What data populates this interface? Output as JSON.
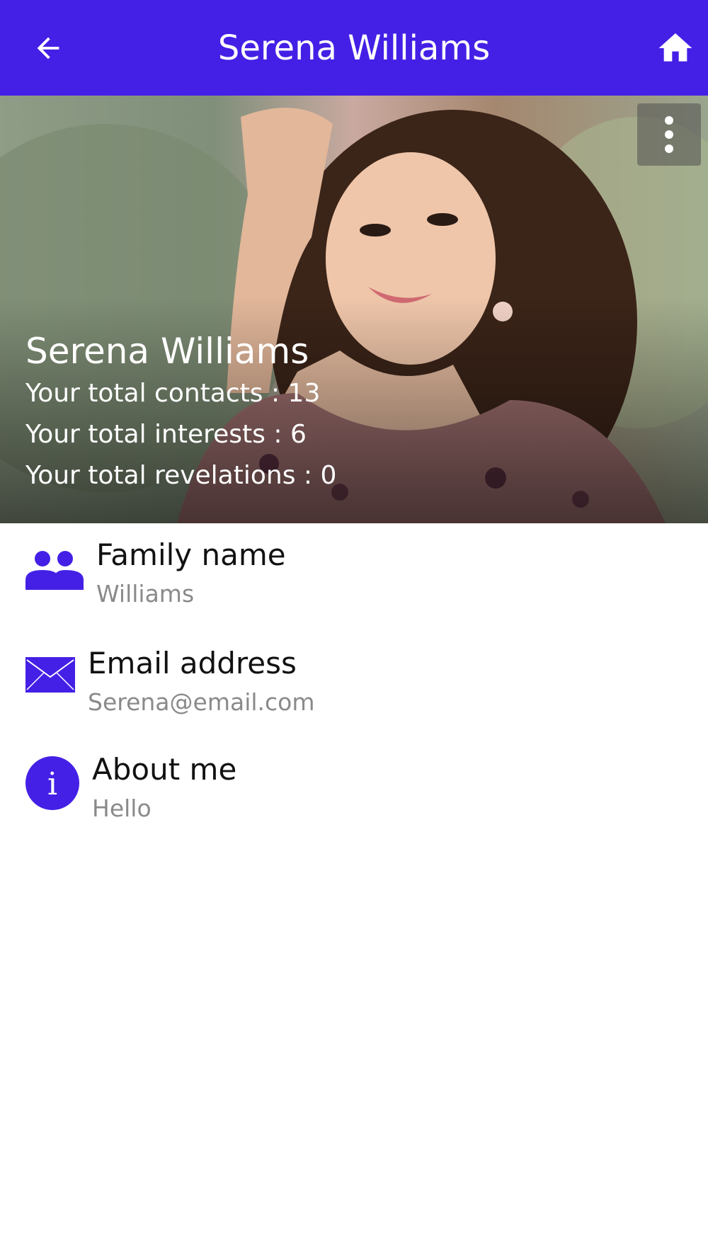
{
  "appbar": {
    "title": "Serena Williams",
    "back_icon": "arrow-left-icon",
    "home_icon": "home-icon",
    "color": "#4420e6"
  },
  "hero": {
    "name": "Serena Williams",
    "stats": {
      "contacts": "Your total contacts : 13",
      "interests": "Your total interests : 6",
      "revelations": "Your total revelations : 0"
    },
    "menu_icon": "more-vert-icon"
  },
  "details": {
    "family": {
      "label": "Family name",
      "value": "Williams",
      "icon": "people-icon"
    },
    "email": {
      "label": "Email address",
      "value": "Serena@email.com",
      "icon": "mail-icon"
    },
    "about": {
      "label": "About me",
      "value": "Hello",
      "icon": "info-icon"
    }
  }
}
